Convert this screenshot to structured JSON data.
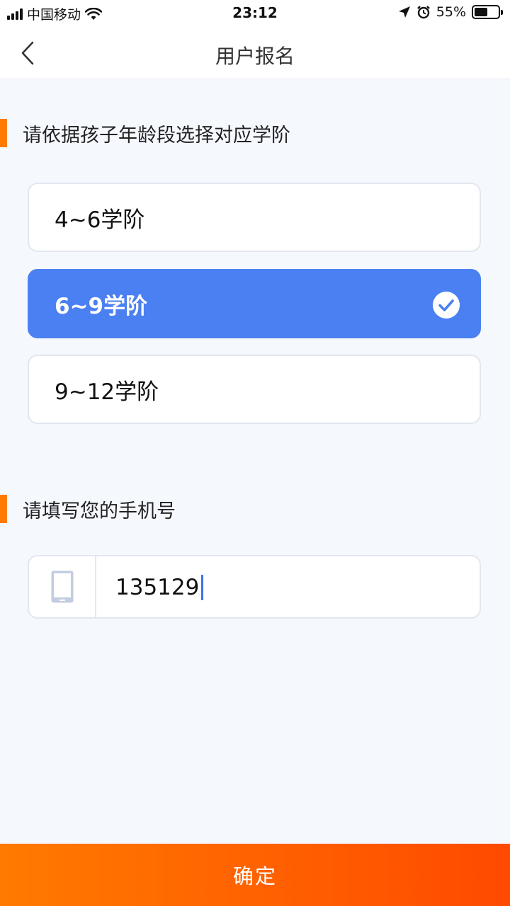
{
  "status_bar": {
    "carrier": "中国移动",
    "time": "23:12",
    "battery": "55%",
    "battery_level": 0.55,
    "icons": [
      "signal-icon",
      "wifi-icon",
      "location-arrow-icon",
      "alarm-icon",
      "battery-icon"
    ]
  },
  "nav": {
    "title": "用户报名",
    "back_icon": "chevron-left-icon"
  },
  "grade_section": {
    "title": "请依据孩子年龄段选择对应学阶",
    "options": [
      {
        "label": "4~6学阶",
        "selected": false
      },
      {
        "label": "6~9学阶",
        "selected": true
      },
      {
        "label": "9~12学阶",
        "selected": false
      }
    ]
  },
  "phone_section": {
    "title": "请填写您的手机号",
    "value": "135129",
    "icon": "mobile-phone-icon"
  },
  "confirm": {
    "label": "确定"
  },
  "colors": {
    "accent_orange": "#ff7a00",
    "selected_blue": "#4b80f2",
    "background": "#f5f8fd"
  }
}
